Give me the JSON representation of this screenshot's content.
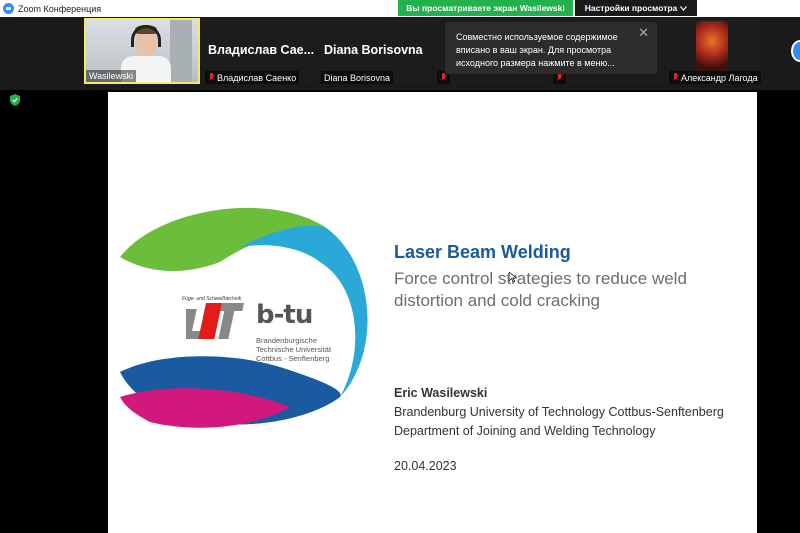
{
  "app": {
    "title": "Zoom Конференция"
  },
  "banners": {
    "sharing": "Вы просматриваете экран Wasilewski",
    "view_options": "Настройки просмотра",
    "view_options_chevron": "chevron-down-icon"
  },
  "tooltip": {
    "text": "Совместно используемое содержимое вписано в ваш экран. Для просмотра исходного размера нажмите в меню...",
    "close": "✕"
  },
  "participants": [
    {
      "name": "Wasilewski",
      "video": true
    },
    {
      "big_name": "Владислав Сае...",
      "name": "Владислав Саенко",
      "muted": true
    },
    {
      "big_name": "Diana Borisovna",
      "name": "Diana Borisovna",
      "muted": false
    },
    {
      "big_name": "",
      "name": "",
      "muted": true
    },
    {
      "big_name": "",
      "name": "",
      "muted": true
    },
    {
      "big_name": "",
      "name": "Александр Лагода",
      "muted": true,
      "avatar": true
    }
  ],
  "slide": {
    "lft_caption": "Füge- und Schweißtechnik",
    "lft_logo": "LFT",
    "btu_logo": "b-tu",
    "btu_lines": [
      "Brandenburgische",
      "Technische Universität",
      "Cottbus - Senftenberg"
    ],
    "title": "Laser Beam Welding",
    "subtitle": "Force control strategies to reduce weld distortion and cold cracking",
    "author": "Eric Wasilewski",
    "affiliation": [
      "Brandenburg University of Technology Cottbus-Senftenberg",
      "Department of Joining and Welding Technology"
    ],
    "date": "20.04.2023",
    "colors": {
      "green": "#6cbd3a",
      "blue": "#1a5aa0",
      "cyan": "#2aa8d8",
      "magenta": "#d2187d"
    }
  }
}
